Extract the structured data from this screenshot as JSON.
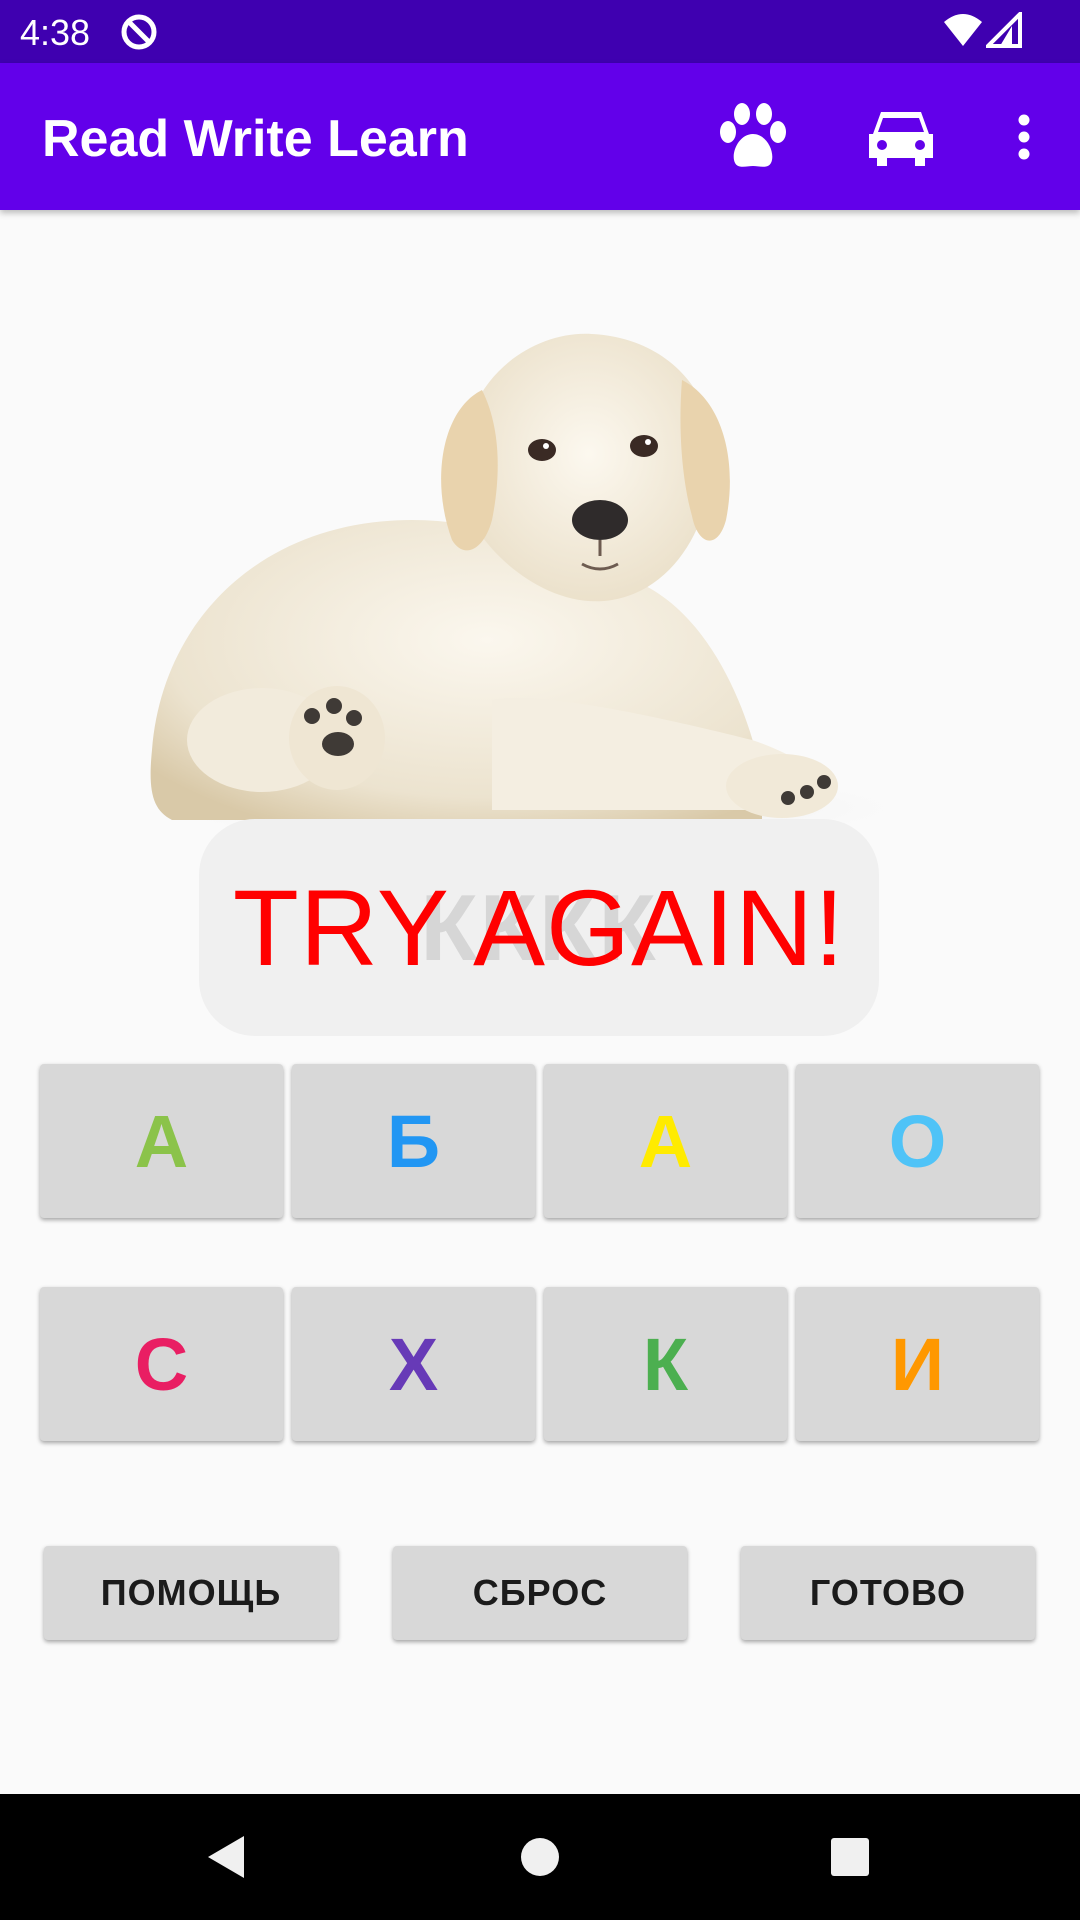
{
  "status_bar": {
    "time": "4:38",
    "icons": [
      "data-saver-icon",
      "wifi-icon",
      "signal-icon"
    ]
  },
  "app_bar": {
    "title": "Read Write Learn",
    "actions": [
      {
        "name": "animals",
        "icon": "paw-icon"
      },
      {
        "name": "vehicles",
        "icon": "car-icon"
      },
      {
        "name": "more",
        "icon": "more-vert-icon"
      }
    ],
    "color": "#6200ea"
  },
  "picture": {
    "subject": "puppy-image"
  },
  "feedback": {
    "message": "TRY AGAIN!",
    "entered_word": "КККК",
    "message_color": "#ff0000"
  },
  "letters": {
    "row1": [
      {
        "letter": "А",
        "color": "#8bc34a"
      },
      {
        "letter": "Б",
        "color": "#2196f3"
      },
      {
        "letter": "А",
        "color": "#ffeb00"
      },
      {
        "letter": "О",
        "color": "#4fc3f7"
      }
    ],
    "row2": [
      {
        "letter": "С",
        "color": "#e91e63"
      },
      {
        "letter": "Х",
        "color": "#673ab7"
      },
      {
        "letter": "К",
        "color": "#4caf50"
      },
      {
        "letter": "И",
        "color": "#ff9800"
      }
    ]
  },
  "actions": {
    "help": "ПОМОЩЬ",
    "reset": "СБРОС",
    "done": "ГОТОВО"
  },
  "nav_bar": {
    "back": "back-icon",
    "home": "home-icon",
    "recents": "recents-icon"
  }
}
